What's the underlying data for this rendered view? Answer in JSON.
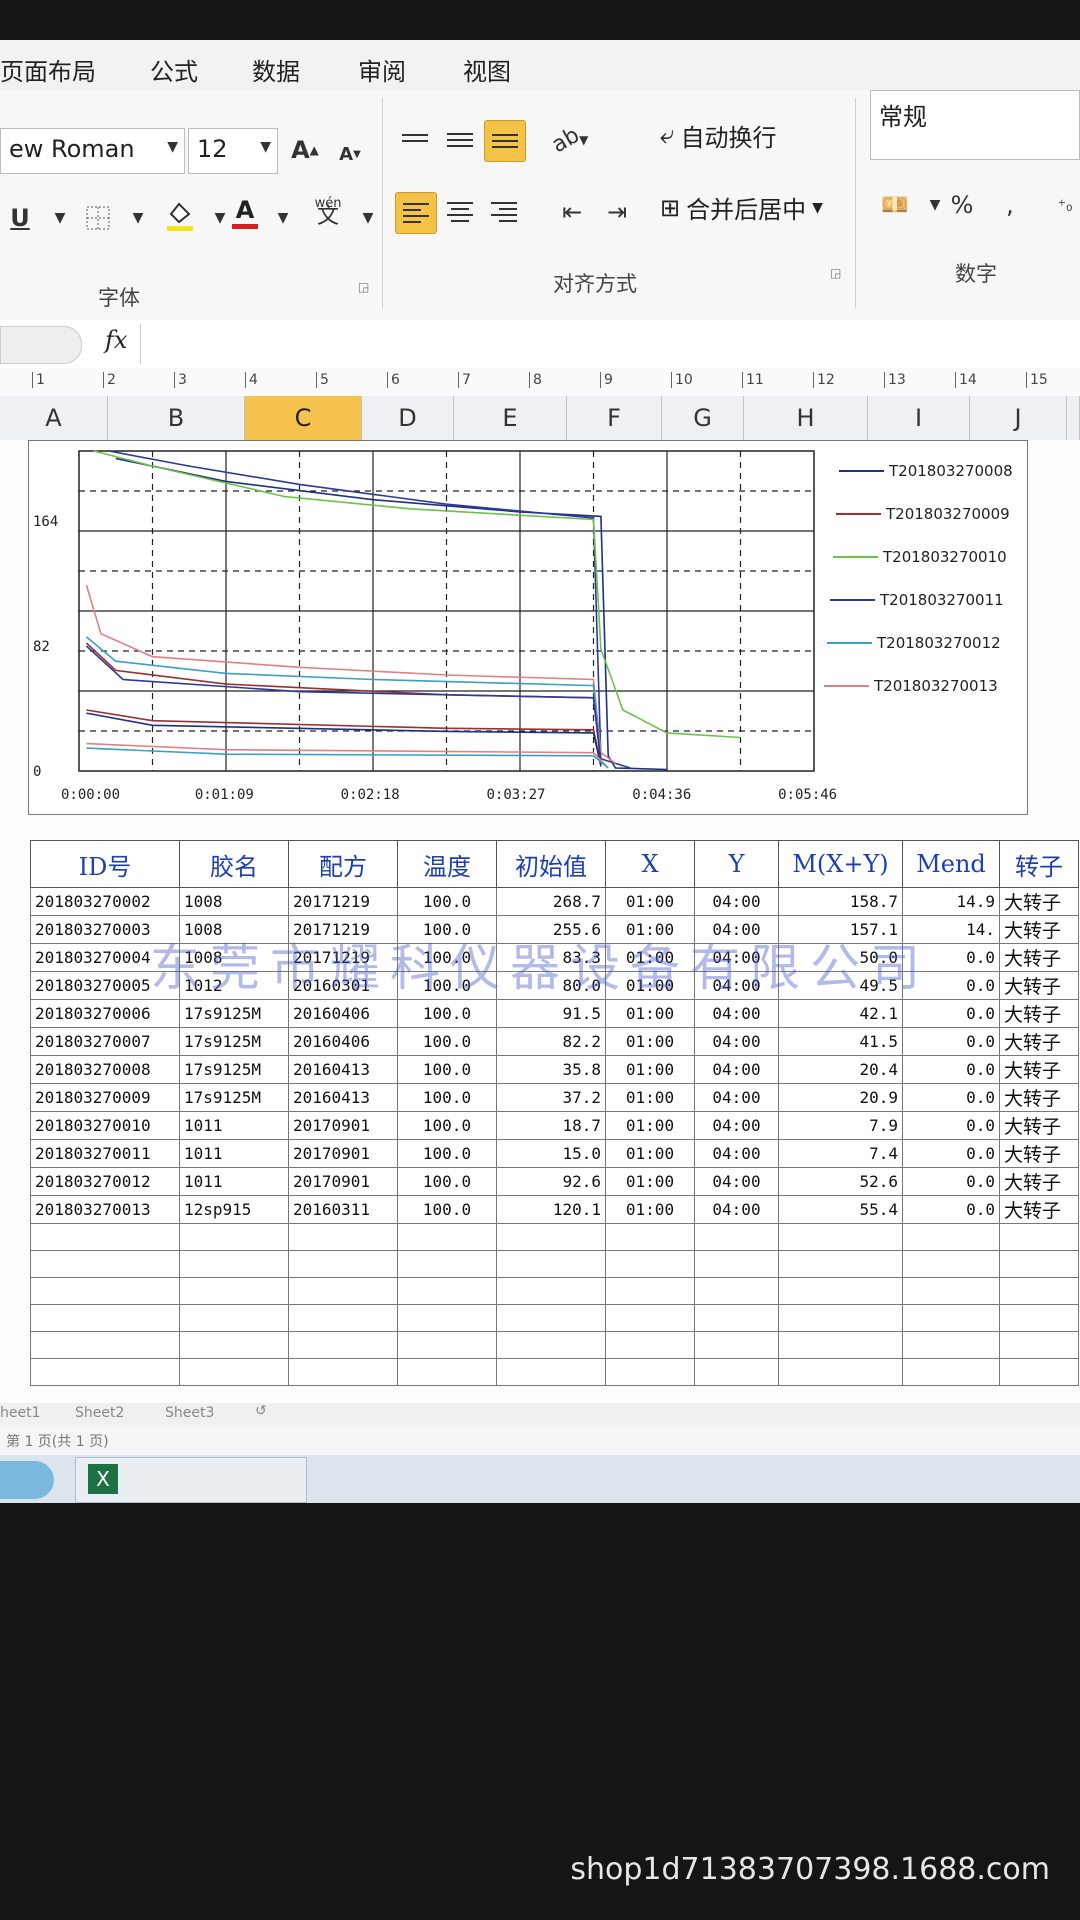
{
  "ribbon": {
    "tabs": [
      "页面布局",
      "公式",
      "数据",
      "审阅",
      "视图"
    ],
    "font_name": "ew Roman",
    "font_size": "12",
    "wrap_text": "自动换行",
    "merge_center": "合并后居中",
    "number_format": "常规",
    "percent": "%",
    "comma": ",",
    "group_font": "字体",
    "group_align": "对齐方式",
    "group_number": "数字",
    "grow_font": "A",
    "shrink_font": "A",
    "underline": "U",
    "font_color": "A",
    "phonetic": "wén"
  },
  "formula_bar": {
    "fx": "fx"
  },
  "ruler": {
    "marks": [
      "1",
      "2",
      "3",
      "4",
      "5",
      "6",
      "7",
      "8",
      "9",
      "10",
      "11",
      "12",
      "13",
      "14",
      "15"
    ]
  },
  "columns": [
    "A",
    "B",
    "C",
    "D",
    "E",
    "F",
    "G",
    "H",
    "I",
    "J"
  ],
  "selected_column": "C",
  "chart_data": {
    "type": "line",
    "x_tick_labels": [
      "0:00:00",
      "0:01:09",
      "0:02:18",
      "0:03:27",
      "0:04:36",
      "0:05:46"
    ],
    "y_tick_labels": [
      "0",
      "82",
      "164"
    ],
    "series": [
      {
        "name": "T201803270008",
        "color": "#1d2f86"
      },
      {
        "name": "T201803270009",
        "color": "#9c2f2f"
      },
      {
        "name": "T201803270010",
        "color": "#6cc24a"
      },
      {
        "name": "T201803270011",
        "color": "#2a3a9a"
      },
      {
        "name": "T201803270012",
        "color": "#3aa0c8"
      },
      {
        "name": "T201803270013",
        "color": "#e08080"
      }
    ]
  },
  "table": {
    "headers": [
      "ID号",
      "胶名",
      "配方",
      "温度",
      "初始值",
      "X",
      "Y",
      "M(X+Y)",
      "Mend",
      "转子"
    ],
    "rows": [
      [
        "201803270002",
        "1008",
        "20171219",
        "100.0",
        "268.7",
        "01:00",
        "04:00",
        "158.7",
        "14.9",
        "大转子"
      ],
      [
        "201803270003",
        "1008",
        "20171219",
        "100.0",
        "255.6",
        "01:00",
        "04:00",
        "157.1",
        "14.",
        "大转子"
      ],
      [
        "201803270004",
        "1008",
        "20171219",
        "100.0",
        "83.3",
        "01:00",
        "04:00",
        "50.0",
        "0.0",
        "大转子"
      ],
      [
        "201803270005",
        "1012",
        "20160301",
        "100.0",
        "80.0",
        "01:00",
        "04:00",
        "49.5",
        "0.0",
        "大转子"
      ],
      [
        "201803270006",
        "17s9125M",
        "20160406",
        "100.0",
        "91.5",
        "01:00",
        "04:00",
        "42.1",
        "0.0",
        "大转子"
      ],
      [
        "201803270007",
        "17s9125M",
        "20160406",
        "100.0",
        "82.2",
        "01:00",
        "04:00",
        "41.5",
        "0.0",
        "大转子"
      ],
      [
        "201803270008",
        "17s9125M",
        "20160413",
        "100.0",
        "35.8",
        "01:00",
        "04:00",
        "20.4",
        "0.0",
        "大转子"
      ],
      [
        "201803270009",
        "17s9125M",
        "20160413",
        "100.0",
        "37.2",
        "01:00",
        "04:00",
        "20.9",
        "0.0",
        "大转子"
      ],
      [
        "201803270010",
        "1011",
        "20170901",
        "100.0",
        "18.7",
        "01:00",
        "04:00",
        "7.9",
        "0.0",
        "大转子"
      ],
      [
        "201803270011",
        "1011",
        "20170901",
        "100.0",
        "15.0",
        "01:00",
        "04:00",
        "7.4",
        "0.0",
        "大转子"
      ],
      [
        "201803270012",
        "1011",
        "20170901",
        "100.0",
        "92.6",
        "01:00",
        "04:00",
        "52.6",
        "0.0",
        "大转子"
      ],
      [
        "201803270013",
        "12sp915",
        "20160311",
        "100.0",
        "120.1",
        "01:00",
        "04:00",
        "55.4",
        "0.0",
        "大转子"
      ]
    ]
  },
  "watermark": "东莞市耀科仪器设备有限公司",
  "sheet_tabs": [
    "heet1",
    "Sheet2",
    "Sheet3"
  ],
  "status": "第 1 页(共 1 页)",
  "footer_url": "shop1d71383707398.1688.com"
}
